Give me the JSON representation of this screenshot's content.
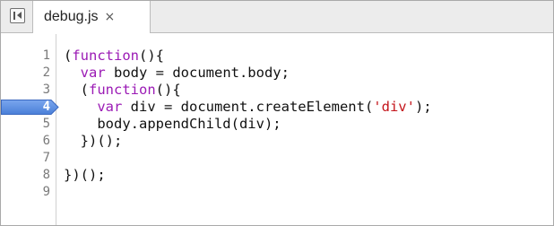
{
  "tab": {
    "title": "debug.js",
    "close_glyph": "×"
  },
  "icons": {
    "panel_toggle": "panel-toggle-icon",
    "close": "close-icon",
    "breakpoint": "breakpoint-marker-icon"
  },
  "colors": {
    "keyword": "#9b1bb5",
    "string": "#c4151b",
    "breakpoint": "#4a7fd8"
  },
  "editor": {
    "breakpoint_line": "4",
    "lines": [
      {
        "num": "1",
        "parts": [
          {
            "t": "(",
            "c": ""
          },
          {
            "t": "function",
            "c": "kw"
          },
          {
            "t": "(){",
            "c": ""
          }
        ]
      },
      {
        "num": "2",
        "parts": [
          {
            "t": "  ",
            "c": ""
          },
          {
            "t": "var",
            "c": "kw"
          },
          {
            "t": " body = document.body;",
            "c": ""
          }
        ]
      },
      {
        "num": "3",
        "parts": [
          {
            "t": "  (",
            "c": ""
          },
          {
            "t": "function",
            "c": "kw"
          },
          {
            "t": "(){",
            "c": ""
          }
        ]
      },
      {
        "num": "4",
        "parts": [
          {
            "t": "    ",
            "c": ""
          },
          {
            "t": "var",
            "c": "kw"
          },
          {
            "t": " div = document.createElement(",
            "c": ""
          },
          {
            "t": "'div'",
            "c": "str"
          },
          {
            "t": ");",
            "c": ""
          }
        ]
      },
      {
        "num": "5",
        "parts": [
          {
            "t": "    body.appendChild(div);",
            "c": ""
          }
        ]
      },
      {
        "num": "6",
        "parts": [
          {
            "t": "  })();",
            "c": ""
          }
        ]
      },
      {
        "num": "7",
        "parts": []
      },
      {
        "num": "8",
        "parts": [
          {
            "t": "})();",
            "c": ""
          }
        ]
      },
      {
        "num": "9",
        "parts": []
      }
    ]
  }
}
